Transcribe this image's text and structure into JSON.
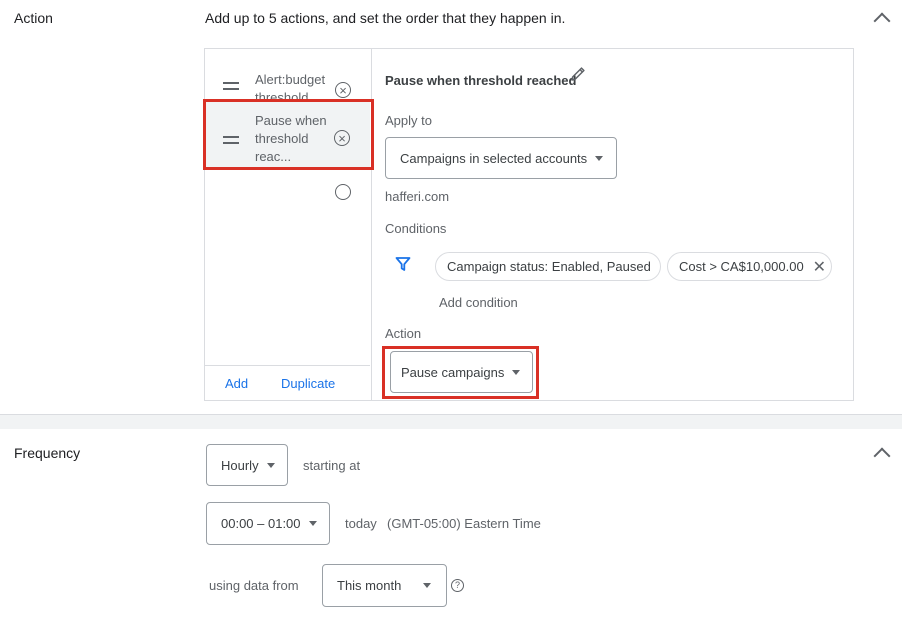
{
  "action_section": {
    "label": "Action",
    "description": "Add up to 5 actions, and set the order that they happen in.",
    "actions": [
      {
        "label_line1": "Alert:budget",
        "label_line2": "threshold",
        "label_line3": ""
      },
      {
        "label_line1": "Pause when",
        "label_line2": "threshold",
        "label_line3": "reac..."
      }
    ],
    "add_label": "Add",
    "duplicate_label": "Duplicate",
    "detail": {
      "title": "Pause when threshold reached",
      "apply_to_label": "Apply to",
      "apply_to_value": "Campaigns in selected accounts",
      "account": "hafferi.com",
      "conditions_label": "Conditions",
      "conditions": [
        "Campaign status: Enabled, Paused",
        "Cost > CA$10,000.00"
      ],
      "add_condition_label": "Add condition",
      "action_label": "Action",
      "action_value": "Pause campaigns"
    }
  },
  "frequency_section": {
    "label": "Frequency",
    "interval_value": "Hourly",
    "starting_at_label": "starting at",
    "time_value": "00:00 – 01:00",
    "today_label": "today",
    "timezone_label": "(GMT-05:00) Eastern Time",
    "using_data_label": "using data from",
    "data_range_value": "This month",
    "help_symbol": "?"
  },
  "colors": {
    "accent": "#1a73e8",
    "highlight": "#d93025",
    "border": "#dadce0"
  },
  "icons": [
    "chevron-up-icon",
    "drag-handle-icon",
    "remove-circle-icon",
    "pencil-icon",
    "filter-icon",
    "close-icon",
    "dropdown-caret-icon",
    "help-icon"
  ]
}
